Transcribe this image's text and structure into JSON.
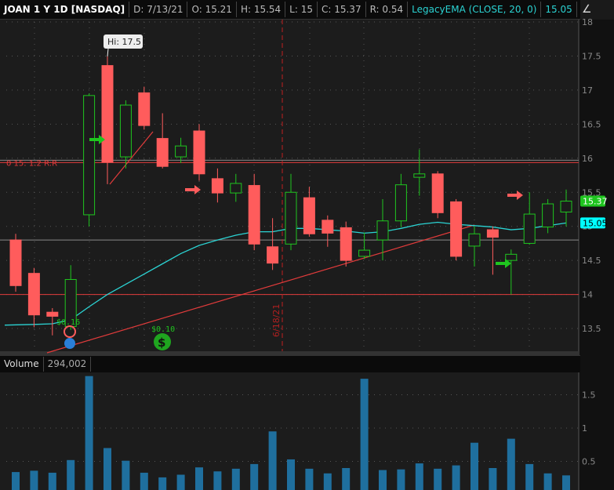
{
  "header": {
    "symbol": "JOAN 1 Y 1D [NASDAQ]",
    "date": "D: 7/13/21",
    "open": "O: 15.21",
    "high": "H: 15.54",
    "low": "L: 15",
    "close": "C: 15.37",
    "range": "R: 0.54",
    "study": "LegacyEMA (CLOSE, 20, 0)",
    "study_value": "15.05"
  },
  "volume_header": {
    "label": "Volume",
    "value": "294,002"
  },
  "colors": {
    "up": "#1fc51f",
    "down": "#ff5c5c",
    "ema": "#2bd3d3",
    "volume": "#1f6f9e",
    "line": "#e23b3b"
  },
  "chart_data": [
    {
      "type": "candlestick",
      "title": "JOAN 1 Y 1D [NASDAQ]",
      "ylim": [
        13.3,
        18.1
      ],
      "yticks": [
        "18",
        "17.5",
        "17",
        "16.5",
        "16",
        "15.5",
        "15",
        "14.5",
        "14",
        "13.5"
      ],
      "ohlc": [
        [
          14.8,
          14.89,
          14.04,
          14.13
        ],
        [
          14.31,
          14.39,
          13.52,
          13.7
        ],
        [
          13.74,
          13.8,
          13.4,
          13.68
        ],
        [
          13.53,
          14.43,
          13.48,
          14.22
        ],
        [
          15.17,
          16.95,
          15.0,
          16.92
        ],
        [
          17.36,
          17.5,
          15.62,
          15.94
        ],
        [
          16.02,
          16.85,
          15.85,
          16.78
        ],
        [
          16.96,
          17.05,
          16.42,
          16.48
        ],
        [
          16.29,
          16.66,
          15.85,
          15.88
        ],
        [
          16.02,
          16.3,
          15.93,
          16.18
        ],
        [
          16.4,
          16.5,
          15.67,
          15.77
        ],
        [
          15.7,
          15.85,
          15.35,
          15.49
        ],
        [
          15.49,
          15.77,
          15.36,
          15.63
        ],
        [
          15.6,
          15.77,
          14.65,
          14.74
        ],
        [
          14.7,
          15.12,
          14.36,
          14.46
        ],
        [
          14.74,
          15.77,
          14.65,
          15.5
        ],
        [
          15.42,
          15.58,
          14.85,
          14.89
        ],
        [
          15.09,
          15.16,
          14.7,
          14.9
        ],
        [
          14.98,
          15.07,
          14.41,
          14.5
        ],
        [
          14.56,
          14.91,
          14.52,
          14.65
        ],
        [
          14.8,
          15.4,
          14.5,
          15.08
        ],
        [
          15.08,
          15.77,
          14.99,
          15.61
        ],
        [
          15.72,
          16.13,
          15.45,
          15.77
        ],
        [
          15.77,
          15.81,
          15.12,
          15.2
        ],
        [
          15.36,
          15.4,
          14.5,
          14.56
        ],
        [
          14.71,
          15.0,
          14.41,
          14.89
        ],
        [
          14.95,
          15.0,
          14.29,
          14.84
        ],
        [
          14.5,
          14.66,
          14.0,
          14.59
        ],
        [
          14.75,
          15.5,
          14.73,
          15.18
        ],
        [
          14.99,
          15.4,
          14.9,
          15.33
        ],
        [
          15.21,
          15.54,
          15.0,
          15.37
        ]
      ],
      "ema": [
        13.55,
        13.56,
        13.57,
        13.63,
        13.82,
        14.0,
        14.15,
        14.3,
        14.45,
        14.6,
        14.72,
        14.8,
        14.87,
        14.92,
        14.92,
        14.97,
        14.97,
        14.95,
        14.93,
        14.9,
        14.92,
        14.97,
        15.03,
        15.06,
        15.03,
        15.01,
        14.99,
        14.95,
        14.97,
        15.01,
        15.05
      ],
      "last_price": "15.37",
      "ema_label": "15.05",
      "annotations": {
        "high_label": "Hi: 17.5",
        "dividends": [
          "$0.16",
          "$0.10"
        ],
        "date_marker": "6/18/21",
        "rr_label": "0 15: 1:2 R:R"
      },
      "hlines": [
        15.97,
        14.8,
        14.0
      ]
    },
    {
      "type": "bar",
      "title": "Volume",
      "unit": "M",
      "yticks": [
        "1.5",
        "1",
        "0.5"
      ],
      "values": [
        0.34,
        0.36,
        0.33,
        0.52,
        1.78,
        0.7,
        0.51,
        0.33,
        0.26,
        0.3,
        0.41,
        0.35,
        0.39,
        0.46,
        0.95,
        0.53,
        0.39,
        0.32,
        0.4,
        1.74,
        0.37,
        0.38,
        0.47,
        0.39,
        0.44,
        0.78,
        0.4,
        0.84,
        0.46,
        0.32,
        0.29
      ]
    }
  ]
}
